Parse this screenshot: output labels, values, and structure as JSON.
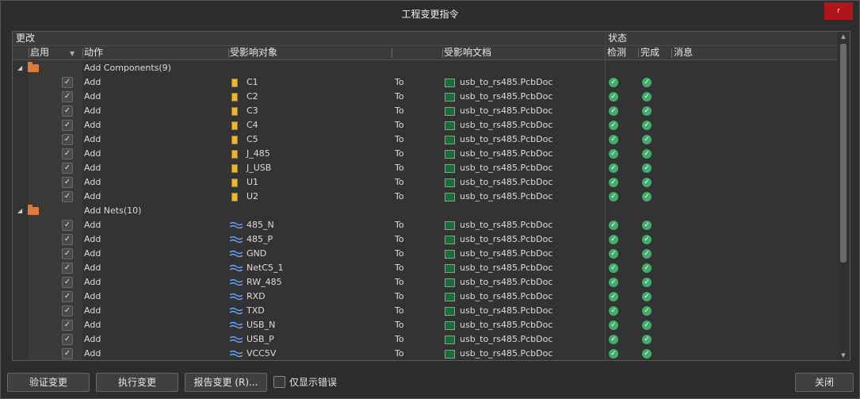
{
  "window": {
    "title": "工程变更指令",
    "close_glyph": "r"
  },
  "headers": {
    "changes": "更改",
    "status": "状态",
    "enable": "启用",
    "action": "动作",
    "affected_object": "受影响对象",
    "affected_document": "受影响文档",
    "check": "检测",
    "done": "完成",
    "message": "消息"
  },
  "groups": [
    {
      "label": "Add Components(9)",
      "rows": [
        {
          "action": "Add",
          "object": "C1",
          "to": "To",
          "doc": "usb_to_rs485.PcbDoc"
        },
        {
          "action": "Add",
          "object": "C2",
          "to": "To",
          "doc": "usb_to_rs485.PcbDoc"
        },
        {
          "action": "Add",
          "object": "C3",
          "to": "To",
          "doc": "usb_to_rs485.PcbDoc"
        },
        {
          "action": "Add",
          "object": "C4",
          "to": "To",
          "doc": "usb_to_rs485.PcbDoc"
        },
        {
          "action": "Add",
          "object": "C5",
          "to": "To",
          "doc": "usb_to_rs485.PcbDoc"
        },
        {
          "action": "Add",
          "object": "J_485",
          "to": "To",
          "doc": "usb_to_rs485.PcbDoc"
        },
        {
          "action": "Add",
          "object": "J_USB",
          "to": "To",
          "doc": "usb_to_rs485.PcbDoc"
        },
        {
          "action": "Add",
          "object": "U1",
          "to": "To",
          "doc": "usb_to_rs485.PcbDoc"
        },
        {
          "action": "Add",
          "object": "U2",
          "to": "To",
          "doc": "usb_to_rs485.PcbDoc"
        }
      ]
    },
    {
      "label": "Add Nets(10)",
      "rows": [
        {
          "action": "Add",
          "object": "485_N",
          "to": "To",
          "doc": "usb_to_rs485.PcbDoc"
        },
        {
          "action": "Add",
          "object": "485_P",
          "to": "To",
          "doc": "usb_to_rs485.PcbDoc"
        },
        {
          "action": "Add",
          "object": "GND",
          "to": "To",
          "doc": "usb_to_rs485.PcbDoc"
        },
        {
          "action": "Add",
          "object": "NetC5_1",
          "to": "To",
          "doc": "usb_to_rs485.PcbDoc"
        },
        {
          "action": "Add",
          "object": "RW_485",
          "to": "To",
          "doc": "usb_to_rs485.PcbDoc"
        },
        {
          "action": "Add",
          "object": "RXD",
          "to": "To",
          "doc": "usb_to_rs485.PcbDoc"
        },
        {
          "action": "Add",
          "object": "TXD",
          "to": "To",
          "doc": "usb_to_rs485.PcbDoc"
        },
        {
          "action": "Add",
          "object": "USB_N",
          "to": "To",
          "doc": "usb_to_rs485.PcbDoc"
        },
        {
          "action": "Add",
          "object": "USB_P",
          "to": "To",
          "doc": "usb_to_rs485.PcbDoc"
        },
        {
          "action": "Add",
          "object": "VCC5V",
          "to": "To",
          "doc": "usb_to_rs485.PcbDoc"
        }
      ]
    }
  ],
  "buttons": {
    "validate": "验证变更",
    "execute": "执行变更",
    "report": "报告变更 (R)...",
    "only_errors": "仅显示错误",
    "close": "关闭"
  },
  "colors": {
    "ok": "#3fae6a",
    "folder": "#e07a3a",
    "component": "#e8b73a",
    "close_button": "#b0151c"
  }
}
